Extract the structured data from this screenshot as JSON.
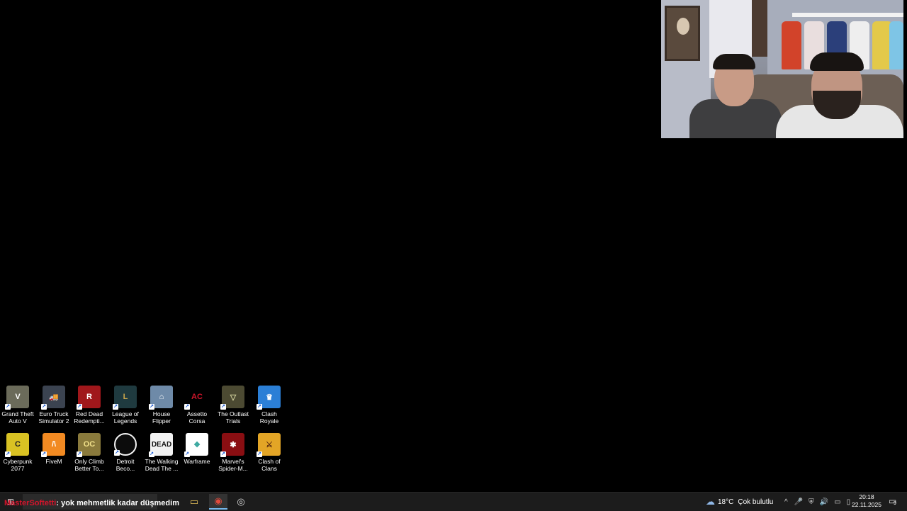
{
  "taskbar": {
    "chat_user": "MasterSoftetti",
    "chat_separator": ": ",
    "chat_message": "yok mehmetlik kadar düşmedim",
    "weather_temp": "18°C",
    "weather_text": "Çok bulutlu",
    "clock_time": "20:18",
    "clock_date": "22.11.2025",
    "notification_count": "9"
  },
  "desktop_icons": [
    {
      "label": "Grand Theft Auto V",
      "icon": "gta5-icon",
      "color": "#6b6b5a"
    },
    {
      "label": "Euro Truck Simulator 2",
      "icon": "truck-icon",
      "color": "#3b4350"
    },
    {
      "label": "Red Dead Redempti...",
      "icon": "rdr-icon",
      "color": "#a0171b"
    },
    {
      "label": "League of Legends",
      "icon": "lol-icon",
      "color": "#1f3a3f"
    },
    {
      "label": "House Flipper",
      "icon": "house-flipper-icon",
      "color": "#6e8aa8"
    },
    {
      "label": "Assetto Corsa",
      "icon": "assetto-corsa-icon",
      "color": "#000000"
    },
    {
      "label": "The Outlast Trials",
      "icon": "outlast-icon",
      "color": "#4c4a32"
    },
    {
      "label": "Clash Royale",
      "icon": "clash-royale-icon",
      "color": "#2b7fd6"
    },
    {
      "label": "Cyberpunk 2077",
      "icon": "cyberpunk-icon",
      "color": "#d9c223"
    },
    {
      "label": "FiveM",
      "icon": "fivem-icon",
      "color": "#f28a22"
    },
    {
      "label": "Only Climb Better To...",
      "icon": "only-climb-icon",
      "color": "#8a7a3c"
    },
    {
      "label": "Detroit Beco...",
      "icon": "detroit-icon",
      "color": "#0c0c0c"
    },
    {
      "label": "The Walking Dead The ...",
      "icon": "walking-dead-icon",
      "color": "#f2f2f2"
    },
    {
      "label": "Warframe",
      "icon": "warframe-icon",
      "color": "#ffffff"
    },
    {
      "label": "Marvel's Spider-M...",
      "icon": "spiderman-icon",
      "color": "#8a0e12"
    },
    {
      "label": "Clash of Clans",
      "icon": "clash-of-clans-icon",
      "color": "#e3a526"
    }
  ]
}
